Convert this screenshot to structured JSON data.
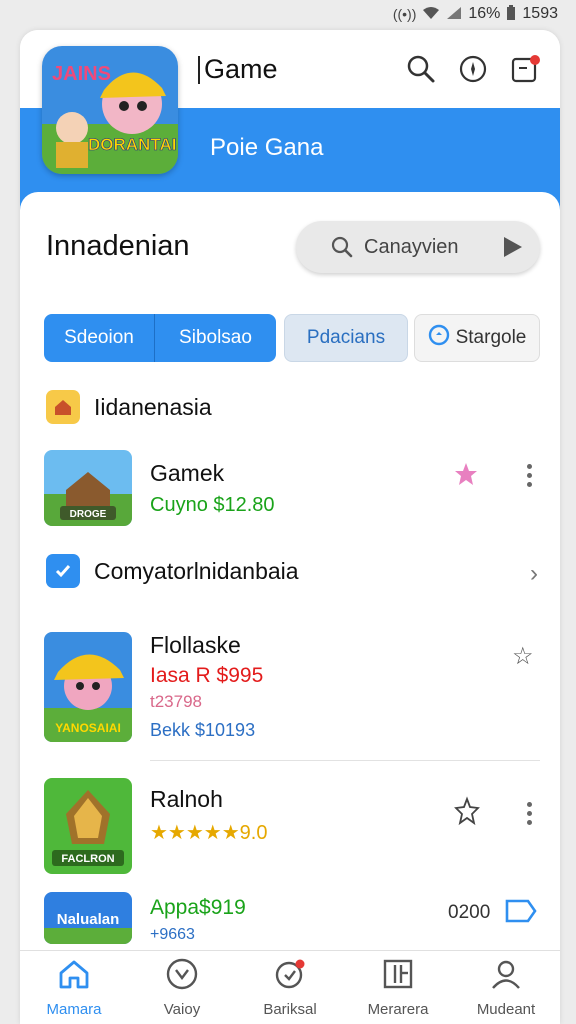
{
  "status_bar": {
    "battery": "16%",
    "time": "1593"
  },
  "header": {
    "title": "Game",
    "banner_text": "Poie Gana",
    "logo_text_top": "JAINS",
    "logo_text_bottom": "DORANTAI"
  },
  "section": {
    "title": "Innadenian",
    "search_label": "Canayvien"
  },
  "segments": [
    "Sdeoion",
    "Sibolsao",
    "Pdacians",
    "Stargole"
  ],
  "category1": {
    "label": "Iidanenasia"
  },
  "item1": {
    "name": "Gamek",
    "price": "Cuyno $12.80",
    "badge": "DROGE"
  },
  "category2": {
    "label": "Comyatorlnidanbaia"
  },
  "item2": {
    "name": "Flollaske",
    "price": "Iasa R $995",
    "old_price": "t23798",
    "sub": "Bekk $10193",
    "badge": "YANOSAIAI"
  },
  "item3": {
    "name": "Ralnoh",
    "rating": "★★★★★9.0",
    "badge": "FACLRON"
  },
  "item4": {
    "name": "Appa$919",
    "sub": "+9663",
    "price": "0200",
    "badge": "Nalualan"
  },
  "bottom_nav": [
    {
      "label": "Mamara"
    },
    {
      "label": "Vaioy"
    },
    {
      "label": "Bariksal"
    },
    {
      "label": "Merarera"
    },
    {
      "label": "Mudeant"
    }
  ],
  "colors": {
    "accent": "#2f8ff0",
    "price_green": "#1aa31a",
    "price_red": "#e31b1b"
  }
}
